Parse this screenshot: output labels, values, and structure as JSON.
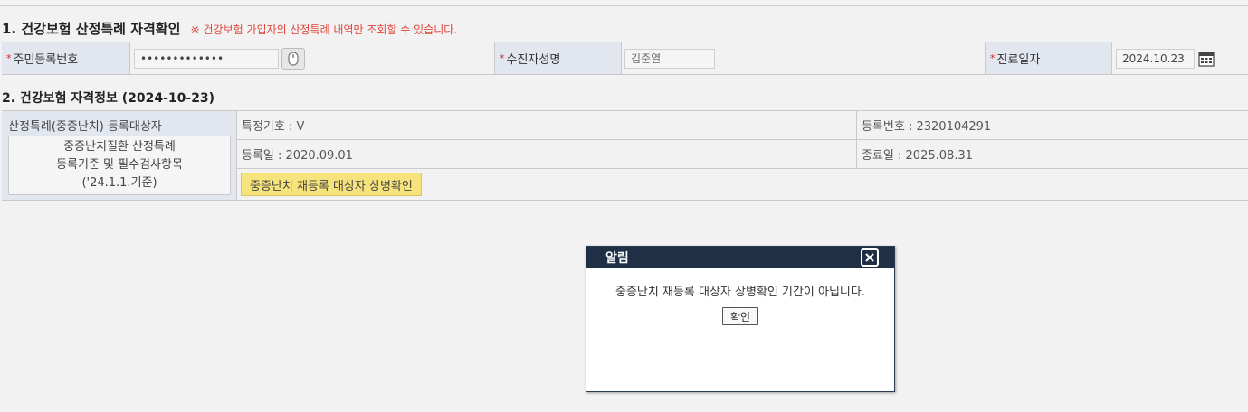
{
  "section1": {
    "title": "1. 건강보험 산정특례 자격확인",
    "note": "※ 건강보험 가입자의 산정특례 내역만 조회할 수 있습니다."
  },
  "form": {
    "required_mark": "*",
    "rrn_label": "주민등록번호",
    "rrn_value": "•••••••••••••",
    "name_label": "수진자성명",
    "name_value": "김준열",
    "date_label": "진료일자",
    "date_value": "2024.10.23",
    "icons": {
      "keypad": "mouse-keypad-icon",
      "calendar": "calendar-icon"
    }
  },
  "section2": {
    "title": "2. 건강보험 자격정보 (2024-10-23)",
    "registrant_caption": "산정특례(중증난치) 등록대상자",
    "standard_button_lines": [
      "중증난치질환 산정특례",
      "등록기준 및 필수검사항목",
      "('24.1.1.기준)"
    ],
    "special_code": "특정기호 : V",
    "reg_number": "등록번호 : 2320104291",
    "reg_date": "등록일 : 2020.09.01",
    "end_date": "종료일 : 2025.08.31",
    "confirm_button": "중증난치 재등록 대상자 상병확인"
  },
  "dialog": {
    "title": "알림",
    "message": "중증난치 재등록 대상자 상병확인 기간이 아닙니다.",
    "ok_label": "확인"
  },
  "colors": {
    "label_bg": "#e1e6ef",
    "required": "#d6272d",
    "note_red": "#e0453a",
    "highlight_button": "#f7e37b",
    "dialog_header": "#1f2f45"
  }
}
